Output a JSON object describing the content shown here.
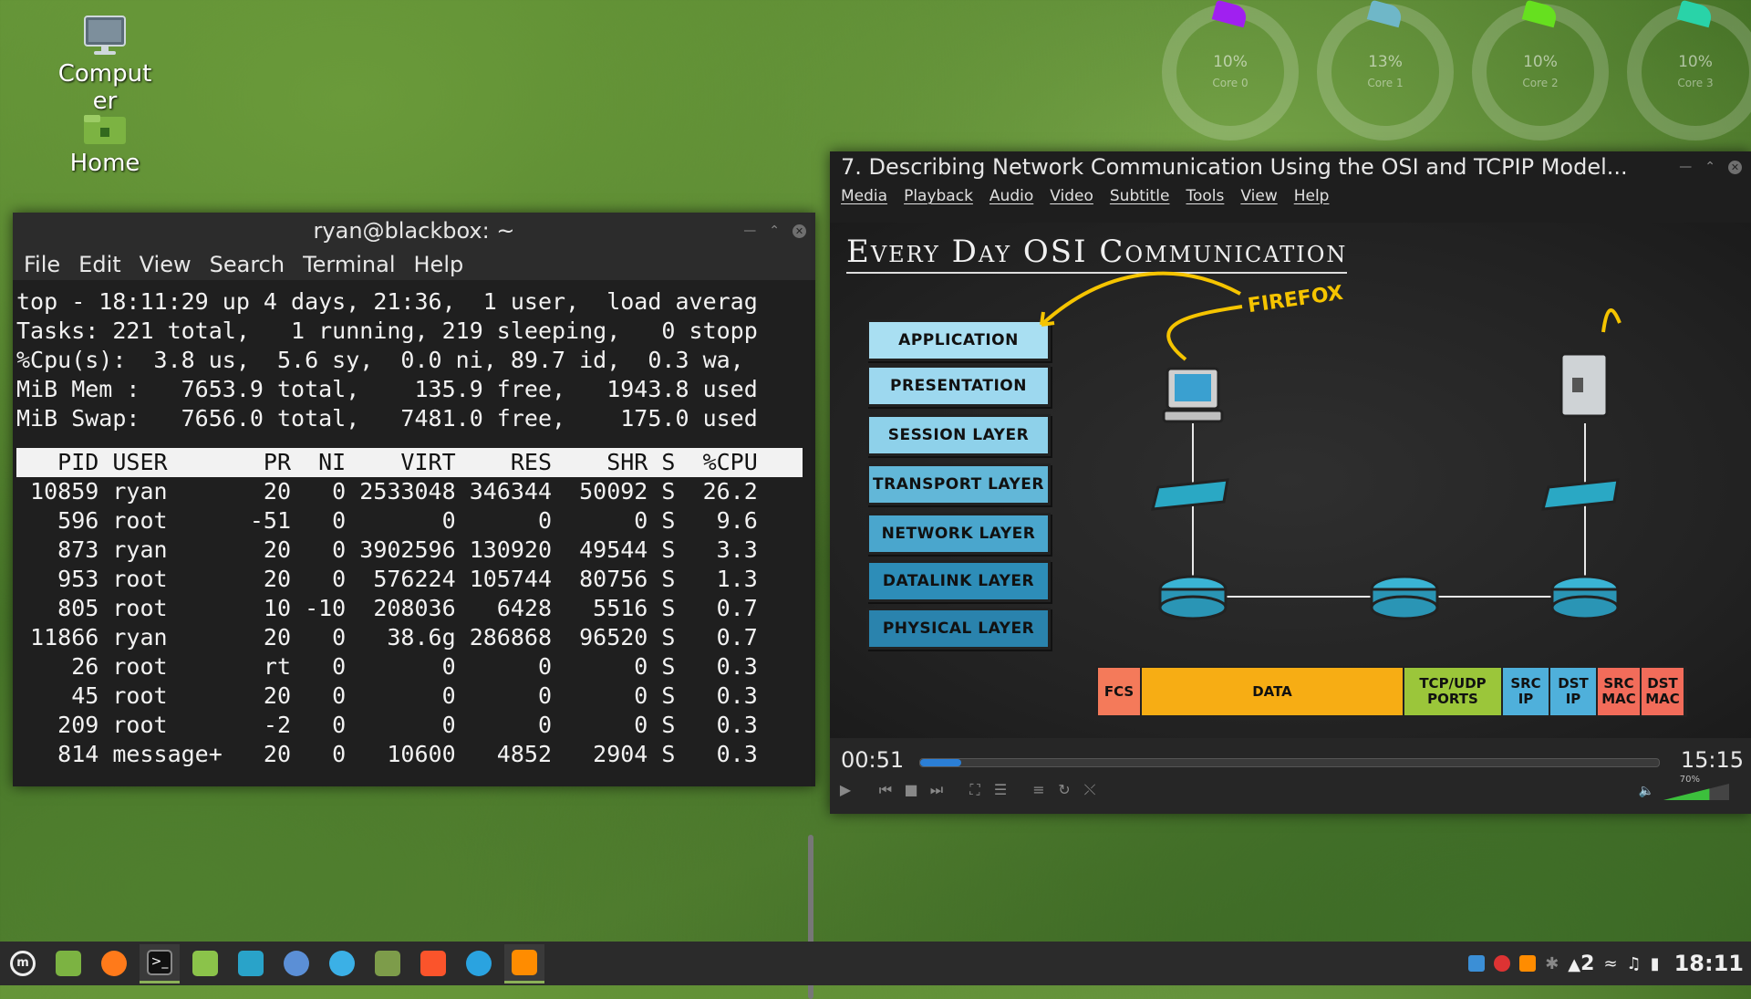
{
  "desktop": {
    "icons": [
      {
        "label": "Computer"
      },
      {
        "label": "Home"
      }
    ]
  },
  "conky": {
    "cores": [
      {
        "pct": "10%",
        "label": "Core 0",
        "color": "#a020f0"
      },
      {
        "pct": "13%",
        "label": "Core 1",
        "color": "#6fb7c8"
      },
      {
        "pct": "10%",
        "label": "Core 2",
        "color": "#66e01f"
      },
      {
        "pct": "10%",
        "label": "Core 3",
        "color": "#29d3a8"
      }
    ]
  },
  "terminal": {
    "title": "ryan@blackbox: ~",
    "menu": [
      "File",
      "Edit",
      "View",
      "Search",
      "Terminal",
      "Help"
    ],
    "summary": [
      "top - 18:11:29 up 4 days, 21:36,  1 user,  load averag",
      "Tasks: 221 total,   1 running, 219 sleeping,   0 stopp",
      "%Cpu(s):  3.8 us,  5.6 sy,  0.0 ni, 89.7 id,  0.3 wa,",
      "MiB Mem :   7653.9 total,    135.9 free,   1943.8 used",
      "MiB Swap:   7656.0 total,   7481.0 free,    175.0 used"
    ],
    "columns": [
      "PID",
      "USER",
      "PR",
      "NI",
      "VIRT",
      "RES",
      "SHR",
      "S",
      "%CPU"
    ],
    "rows": [
      [
        "10859",
        "ryan",
        "20",
        "0",
        "2533048",
        "346344",
        "50092",
        "S",
        "26.2"
      ],
      [
        "596",
        "root",
        "-51",
        "0",
        "0",
        "0",
        "0",
        "S",
        "9.6"
      ],
      [
        "873",
        "ryan",
        "20",
        "0",
        "3902596",
        "130920",
        "49544",
        "S",
        "3.3"
      ],
      [
        "953",
        "root",
        "20",
        "0",
        "576224",
        "105744",
        "80756",
        "S",
        "1.3"
      ],
      [
        "805",
        "root",
        "10",
        "-10",
        "208036",
        "6428",
        "5516",
        "S",
        "0.7"
      ],
      [
        "11866",
        "ryan",
        "20",
        "0",
        "38.6g",
        "286868",
        "96520",
        "S",
        "0.7"
      ],
      [
        "26",
        "root",
        "rt",
        "0",
        "0",
        "0",
        "0",
        "S",
        "0.3"
      ],
      [
        "45",
        "root",
        "20",
        "0",
        "0",
        "0",
        "0",
        "S",
        "0.3"
      ],
      [
        "209",
        "root",
        "-2",
        "0",
        "0",
        "0",
        "0",
        "S",
        "0.3"
      ],
      [
        "814",
        "message+",
        "20",
        "0",
        "10600",
        "4852",
        "2904",
        "S",
        "0.3"
      ]
    ]
  },
  "vlc": {
    "title": "7. Describing Network Communication Using the OSI and TCPIP Model...",
    "menu": [
      "Media",
      "Playback",
      "Audio",
      "Video",
      "Subtitle",
      "Tools",
      "View",
      "Help"
    ],
    "video": {
      "heading": "Every Day OSI Communication",
      "layers": [
        {
          "label": "APPLICATION LAYER",
          "color": "#a9dff2"
        },
        {
          "label": "PRESENTATION LAYER",
          "color": "#9dd8ef"
        },
        {
          "label": "SESSION LAYER",
          "color": "#8ed1ea"
        },
        {
          "label": "TRANSPORT LAYER",
          "color": "#62b7d8"
        },
        {
          "label": "NETWORK LAYER",
          "color": "#4aa6cd"
        },
        {
          "label": "DATALINK LAYER",
          "color": "#2d8db8"
        },
        {
          "label": "PHYSICAL LAYER",
          "color": "#2a83ad"
        }
      ],
      "firefox_label": "FIREFOX",
      "frame": [
        {
          "label": "FCS",
          "color": "#f47a5a"
        },
        {
          "label": "DATA",
          "color": "#f7ad14"
        },
        {
          "label": "TCP/UDP PORTS",
          "color": "#9bc63a"
        },
        {
          "label": "SRC IP",
          "color": "#4fb0db"
        },
        {
          "label": "DST IP",
          "color": "#4fb0db"
        },
        {
          "label": "SRC MAC",
          "color": "#f26c5a"
        },
        {
          "label": "DST MAC",
          "color": "#f26c5a"
        }
      ]
    },
    "time_elapsed": "00:51",
    "time_total": "15:15",
    "progress": 0.056,
    "volume_label": "70%",
    "volume": 0.7
  },
  "taskbar": {
    "apps": [
      "menu-icon",
      "files-icon",
      "firefox-icon",
      "terminal-icon",
      "folder-icon",
      "monitor-icon",
      "chromium-icon",
      "edge-icon",
      "tool-icon",
      "brave-icon",
      "telegram-icon",
      "vlc-icon"
    ],
    "tray_count": "2",
    "clock": "18:11"
  }
}
